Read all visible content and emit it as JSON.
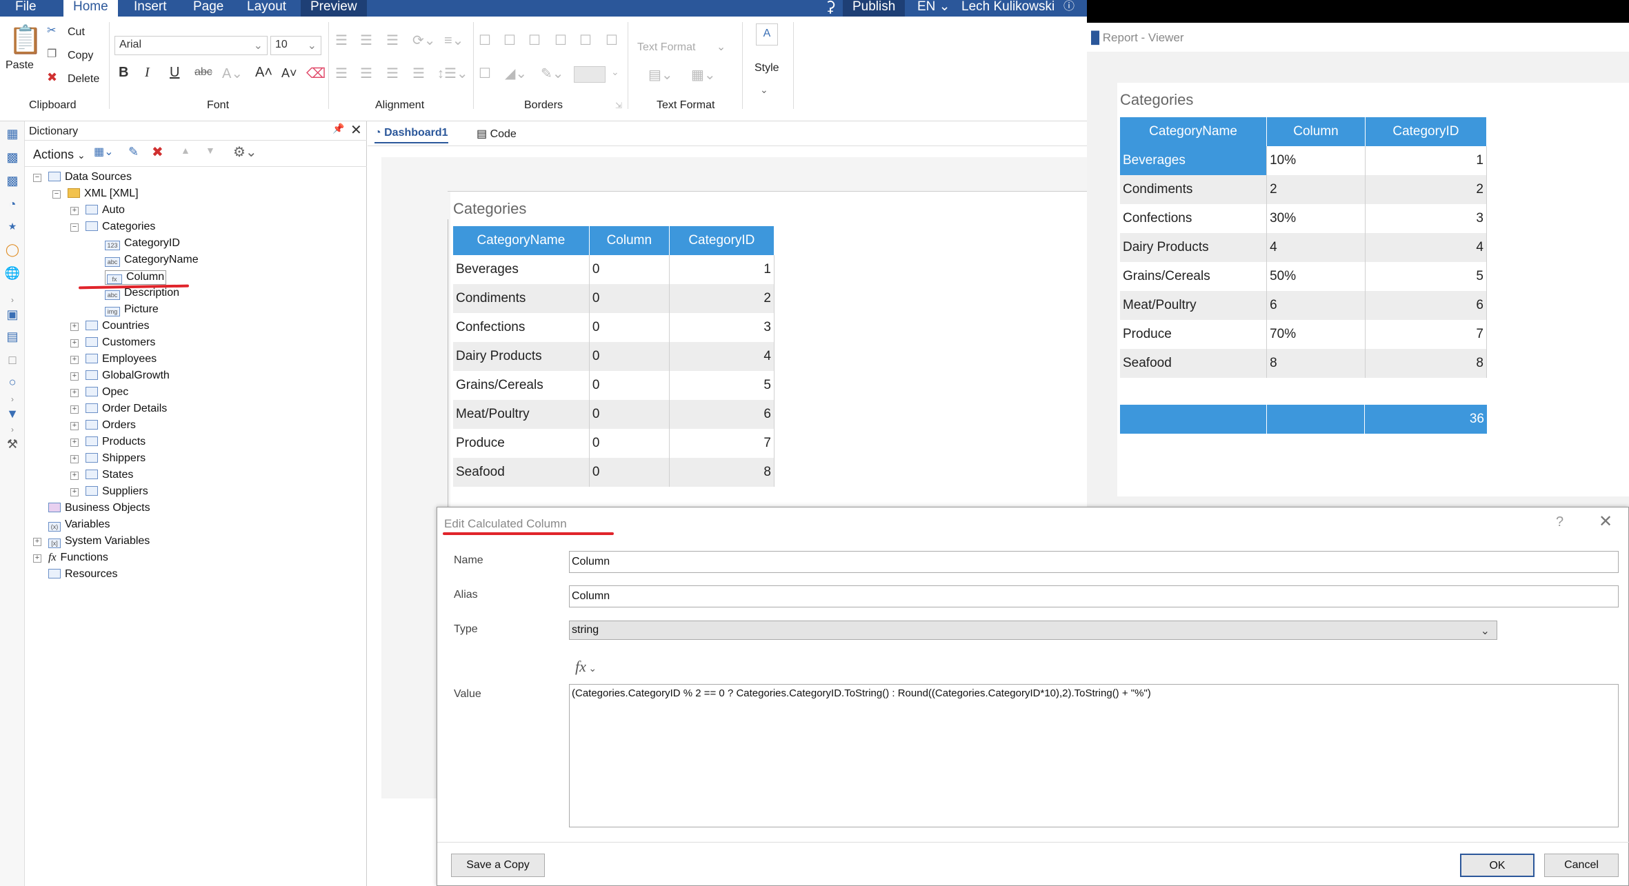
{
  "menu": {
    "tabs": [
      "File",
      "Home",
      "Insert",
      "Page",
      "Layout",
      "Preview"
    ],
    "publish": "Publish",
    "lang": "EN",
    "user": "Lech Kulikowski"
  },
  "ribbon": {
    "clipboard": {
      "paste": "Paste",
      "cut": "Cut",
      "copy": "Copy",
      "delete": "Delete",
      "label": "Clipboard"
    },
    "font": {
      "name": "Arial",
      "size": "10",
      "label": "Font"
    },
    "alignment": {
      "label": "Alignment"
    },
    "borders": {
      "label": "Borders"
    },
    "text_format": {
      "value": "Text Format",
      "label": "Text Format"
    },
    "style": {
      "label": "Style"
    }
  },
  "dictionary": {
    "title": "Dictionary",
    "actions": "Actions",
    "tree": {
      "data_sources": "Data Sources",
      "xml": "XML [XML]",
      "auto": "Auto",
      "categories": "Categories",
      "fields": [
        "CategoryID",
        "CategoryName",
        "Column",
        "Description",
        "Picture"
      ],
      "tables": [
        "Countries",
        "Customers",
        "Employees",
        "GlobalGrowth",
        "Opec",
        "Order Details",
        "Orders",
        "Products",
        "Shippers",
        "States",
        "Suppliers"
      ],
      "roots": [
        "Business Objects",
        "Variables",
        "System Variables",
        "Functions",
        "Resources"
      ]
    }
  },
  "doc_tabs": {
    "dashboard": "Dashboard1",
    "code": "Code"
  },
  "designer_table": {
    "title": "Categories",
    "headers": [
      "CategoryName",
      "Column",
      "CategoryID"
    ],
    "rows": [
      [
        "Beverages",
        "0",
        "1"
      ],
      [
        "Condiments",
        "0",
        "2"
      ],
      [
        "Confections",
        "0",
        "3"
      ],
      [
        "Dairy Products",
        "0",
        "4"
      ],
      [
        "Grains/Cereals",
        "0",
        "5"
      ],
      [
        "Meat/Poultry",
        "0",
        "6"
      ],
      [
        "Produce",
        "0",
        "7"
      ],
      [
        "Seafood",
        "0",
        "8"
      ]
    ]
  },
  "viewer": {
    "window_title": "Report - Viewer",
    "title": "Categories",
    "headers": [
      "CategoryName",
      "Column",
      "CategoryID"
    ],
    "rows": [
      [
        "Beverages",
        "10%",
        "1"
      ],
      [
        "Condiments",
        "2",
        "2"
      ],
      [
        "Confections",
        "30%",
        "3"
      ],
      [
        "Dairy Products",
        "4",
        "4"
      ],
      [
        "Grains/Cereals",
        "50%",
        "5"
      ],
      [
        "Meat/Poultry",
        "6",
        "6"
      ],
      [
        "Produce",
        "70%",
        "7"
      ],
      [
        "Seafood",
        "8",
        "8"
      ]
    ],
    "total": "36"
  },
  "dialog": {
    "title": "Edit Calculated Column",
    "help": "?",
    "name_label": "Name",
    "name_value": "Column",
    "alias_label": "Alias",
    "alias_value": "Column",
    "type_label": "Type",
    "type_value": "string",
    "fx": "fx",
    "value_label": "Value",
    "value_expr": "(Categories.CategoryID % 2 == 0 ? Categories.CategoryID.ToString() : Round((Categories.CategoryID*10),2).ToString() + \"%\")",
    "save_copy": "Save a Copy",
    "ok": "OK",
    "cancel": "Cancel"
  },
  "colors": {
    "accent": "#2b579a",
    "header": "#3d97dc",
    "highlight": "#e0242b"
  }
}
